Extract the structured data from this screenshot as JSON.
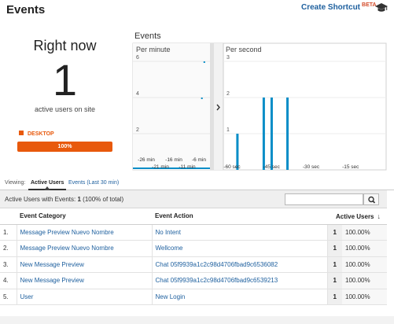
{
  "header": {
    "title": "Events",
    "shortcut_label": "Create Shortcut",
    "beta_label": "BETA"
  },
  "summary": {
    "right_now_label": "Right now",
    "active_count": "1",
    "active_label": "active users on site",
    "device_label": "DESKTOP",
    "device_percent": "100%",
    "device_color": "#e8590c"
  },
  "chart_data": {
    "type": "bar",
    "title": "Events",
    "panels": [
      {
        "name": "Per minute",
        "x_ticks": [
          "-26 min",
          "-21 min",
          "-16 min",
          "-11 min",
          "-6 min"
        ],
        "y_ticks": [
          "2",
          "4",
          "6"
        ],
        "values": [
          0,
          0,
          0,
          0,
          0,
          0,
          0,
          0,
          0,
          0,
          0,
          0,
          0,
          0,
          0,
          0,
          0,
          0,
          0,
          0,
          0,
          0,
          0,
          0,
          0,
          0,
          0,
          4,
          6,
          0
        ],
        "current_value": 0
      },
      {
        "name": "Per second",
        "x_ticks": [
          "-60 sec",
          "-45 sec",
          "-30 sec",
          "-15 sec"
        ],
        "y_ticks": [
          "1",
          "2",
          "3"
        ],
        "values": [
          1,
          2,
          2,
          2
        ],
        "x": [
          -56,
          -46,
          -43,
          -37
        ]
      }
    ]
  },
  "tabs": {
    "viewing_label": "Viewing:",
    "active": "Active Users",
    "other": "Events (Last 30 min)"
  },
  "table_summary": {
    "prefix": "Active Users with Events:",
    "count": "1",
    "detail": "(100% of total)"
  },
  "table": {
    "headers": {
      "category": "Event Category",
      "action": "Event Action",
      "active_users": "Active Users"
    },
    "rows": [
      {
        "idx": "1.",
        "category": "Message Preview Nuevo Nombre",
        "action": "No Intent",
        "count": "1",
        "pct": "100.00%"
      },
      {
        "idx": "2.",
        "category": "Message Preview Nuevo Nombre",
        "action": "Wellcome",
        "count": "1",
        "pct": "100.00%"
      },
      {
        "idx": "3.",
        "category": "New Message Preview",
        "action": "Chat 05f9939a1c2c98d4706fbad9c6536082",
        "count": "1",
        "pct": "100.00%"
      },
      {
        "idx": "4.",
        "category": "New Message Preview",
        "action": "Chat 05f9939a1c2c98d4706fbad9c6539213",
        "count": "1",
        "pct": "100.00%"
      },
      {
        "idx": "5.",
        "category": "User",
        "action": "New Login",
        "count": "1",
        "pct": "100.00%"
      }
    ]
  },
  "icons": {
    "cap": "graduation-cap-icon",
    "search": "search-icon",
    "sort": "sort-desc-icon",
    "panel_toggle": "chevron-right-icon"
  },
  "colors": {
    "link": "#1d5f9e",
    "bar": "#058dc7",
    "accent": "#e8590c"
  }
}
